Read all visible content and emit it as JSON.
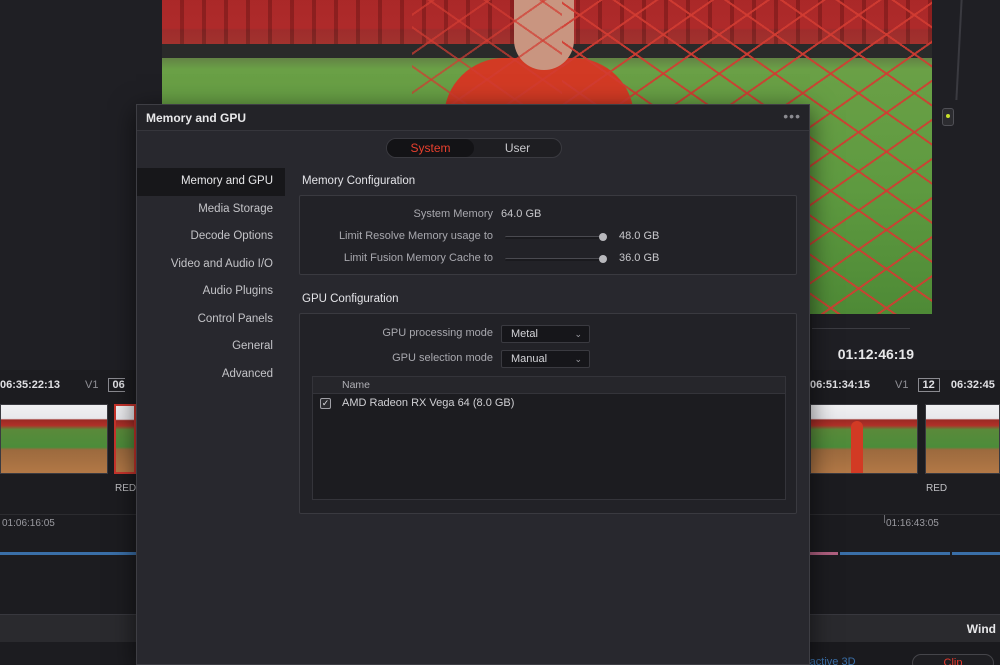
{
  "background": {
    "viewer_timecode": "01:12:46:19",
    "timeline_left": {
      "timecode": "06:35:22:13",
      "track": "V1",
      "clip_number": "06",
      "clip_label": "RED",
      "ruler_time": "01:06:16:05"
    },
    "timeline_right": {
      "timecode": "06:51:34:15",
      "track": "V1",
      "clip_number": "12",
      "timecode2": "06:32:45",
      "clip_label": "RED",
      "ruler_time": "01:16:43:05"
    },
    "bottom_right_label": "Wind",
    "bottom_partial_text": "ractive 3D",
    "bottom_partial_button": "Clip"
  },
  "dialog": {
    "title": "Memory and GPU",
    "menu_icon": "ellipsis-icon",
    "tabs": [
      {
        "label": "System",
        "active": true
      },
      {
        "label": "User",
        "active": false
      }
    ],
    "sidebar": [
      {
        "label": "Memory and GPU",
        "active": true
      },
      {
        "label": "Media Storage"
      },
      {
        "label": "Decode Options"
      },
      {
        "label": "Video and Audio I/O"
      },
      {
        "label": "Audio Plugins"
      },
      {
        "label": "Control Panels"
      },
      {
        "label": "General"
      },
      {
        "label": "Advanced"
      }
    ],
    "memory": {
      "section_title": "Memory Configuration",
      "system_memory_label": "System Memory",
      "system_memory_value": "64.0 GB",
      "resolve_label": "Limit Resolve Memory usage to",
      "resolve_value": "48.0 GB",
      "fusion_label": "Limit Fusion Memory Cache to",
      "fusion_value": "36.0 GB"
    },
    "gpu": {
      "section_title": "GPU Configuration",
      "processing_mode_label": "GPU processing mode",
      "processing_mode_value": "Metal",
      "selection_mode_label": "GPU selection mode",
      "selection_mode_value": "Manual",
      "table_header": "Name",
      "devices": [
        {
          "name": "AMD Radeon RX Vega 64 (8.0 GB)",
          "checked": true
        }
      ]
    }
  },
  "colors": {
    "accent_red": "#e8402e",
    "dialog_bg": "#28282e",
    "track_blue": "#3a6fa8"
  }
}
